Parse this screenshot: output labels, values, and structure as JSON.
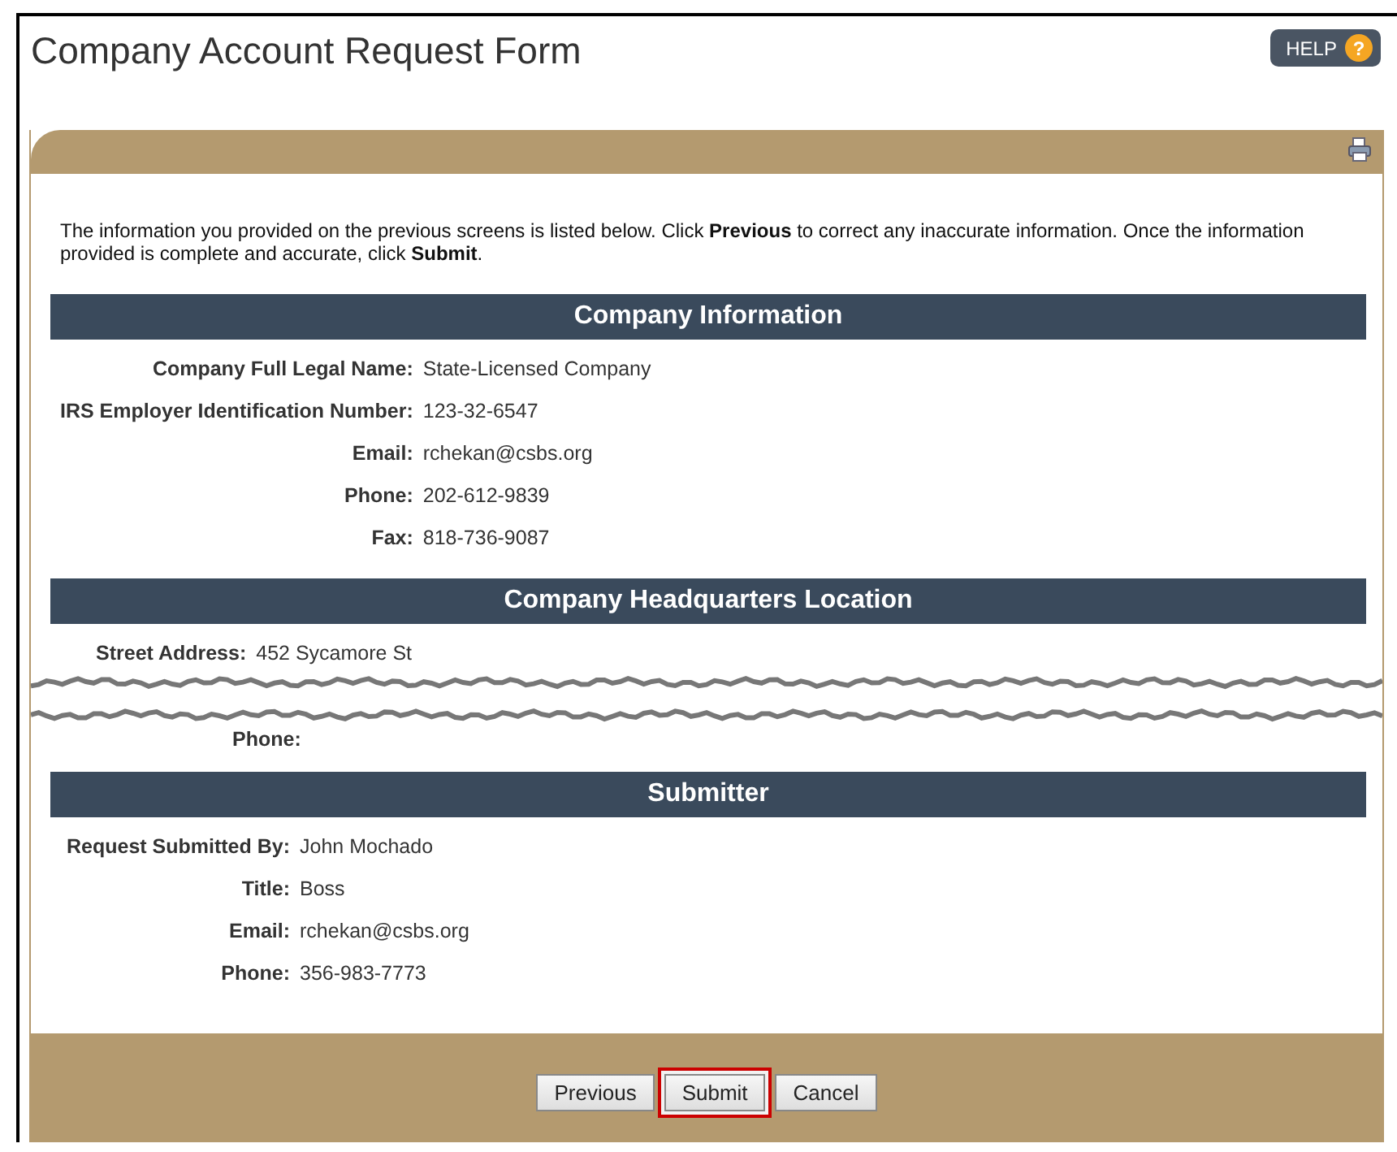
{
  "title": "Company Account Request Form",
  "help_button": {
    "label": "HELP",
    "icon_text": "?"
  },
  "intro": "The information you provided on the previous screens is listed below. Click **Previous** to correct any inaccurate information. Once the information provided is complete and accurate, click **Submit**.",
  "blocks": [
    {
      "kind": "section",
      "heading": "Company Information",
      "fields": [
        {
          "label": "Company Full Legal Name:",
          "value": "State-Licensed Company"
        },
        {
          "label": "IRS Employer Identification Number:",
          "value": "123-32-6547"
        },
        {
          "label": "Email:",
          "value": "rchekan@csbs.org"
        },
        {
          "label": "Phone:",
          "value": "202-612-9839"
        },
        {
          "label": "Fax:",
          "value": "818-736-9087"
        }
      ]
    },
    {
      "kind": "section",
      "heading": "Company Headquarters Location",
      "fields": [
        {
          "label": "Street Address:",
          "value": "452 Sycamore St"
        }
      ]
    },
    {
      "kind": "tear"
    },
    {
      "kind": "fields",
      "fields": [
        {
          "label": "Phone:"
        }
      ]
    },
    {
      "kind": "section",
      "heading": "Submitter",
      "fields": [
        {
          "label": "Request Submitted By:",
          "value": "John Mochado"
        },
        {
          "label": "Title:",
          "value": "Boss"
        },
        {
          "label": "Email:",
          "value": "rchekan@csbs.org"
        },
        {
          "label": "Phone:",
          "value": "356-983-7773"
        }
      ]
    }
  ],
  "buttons": [
    {
      "label": "Previous",
      "highlighted": false
    },
    {
      "label": "Submit",
      "highlighted": true
    },
    {
      "label": "Cancel",
      "highlighted": false
    }
  ]
}
